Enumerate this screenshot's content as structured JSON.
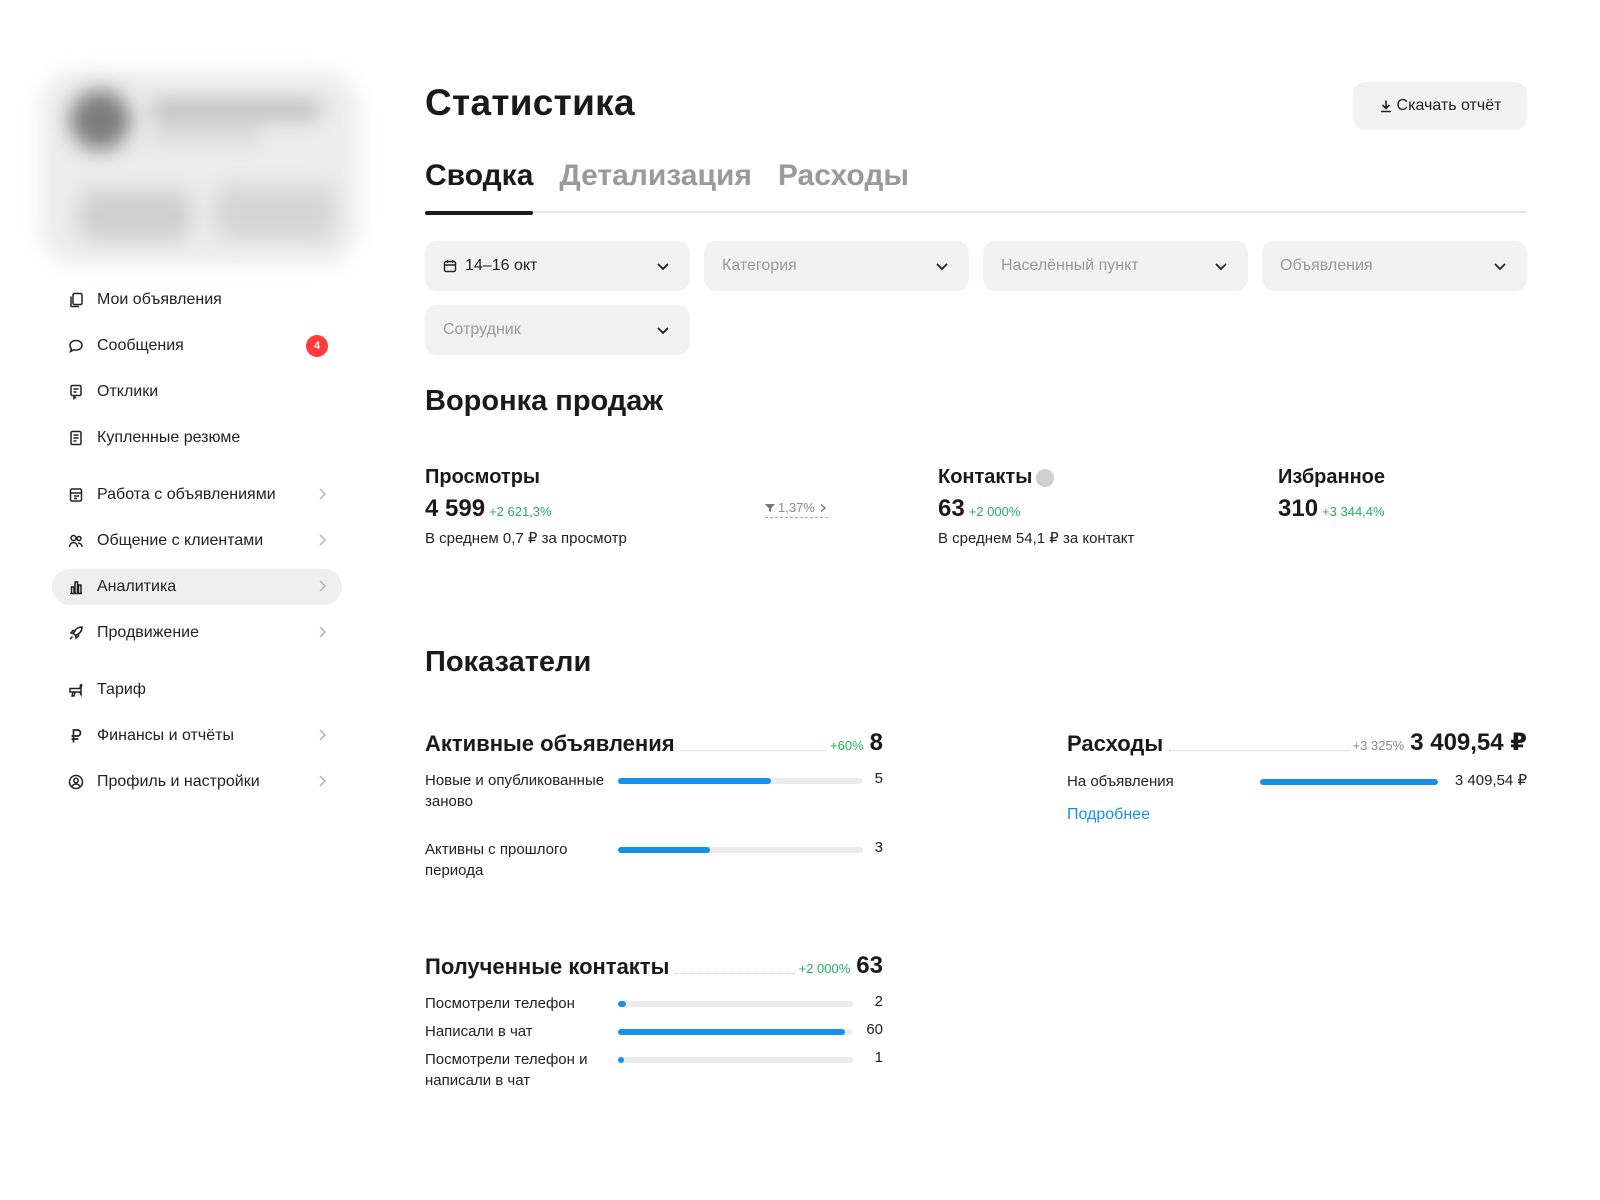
{
  "sidebar": {
    "items": [
      {
        "label": "Мои объявления",
        "icon": "ad-copy-icon",
        "chevron": false
      },
      {
        "label": "Сообщения",
        "icon": "chat-bubble-icon",
        "chevron": false,
        "badge": "4"
      },
      {
        "label": "Отклики",
        "icon": "responses-icon",
        "chevron": false
      },
      {
        "label": "Купленные резюме",
        "icon": "resume-icon",
        "chevron": false
      },
      {
        "label": "Работа с объявлениями",
        "icon": "ads-work-icon",
        "chevron": true
      },
      {
        "label": "Общение с клиентами",
        "icon": "clients-icon",
        "chevron": true
      },
      {
        "label": "Аналитика",
        "icon": "analytics-icon",
        "chevron": true,
        "active": true
      },
      {
        "label": "Продвижение",
        "icon": "rocket-icon",
        "chevron": true
      },
      {
        "label": "Тариф",
        "icon": "tariff-icon",
        "chevron": false
      },
      {
        "label": "Финансы и отчёты",
        "icon": "ruble-icon",
        "chevron": true
      },
      {
        "label": "Профиль и настройки",
        "icon": "profile-icon",
        "chevron": true
      }
    ]
  },
  "header": {
    "title": "Статистика",
    "download_label": "Скачать отчёт"
  },
  "tabs": [
    "Сводка",
    "Детализация",
    "Расходы"
  ],
  "filters": {
    "date": "14–16 окт",
    "category": "Категория",
    "locality": "Населённый пункт",
    "ads": "Объявления",
    "employee": "Сотрудник"
  },
  "funnel": {
    "title": "Воронка продаж",
    "views": {
      "label": "Просмотры",
      "value": "4 599",
      "delta": "+2 621,3%",
      "note": "В среднем 0,7 ₽ за просмотр"
    },
    "conversion": "1,37%",
    "contacts": {
      "label": "Контакты",
      "value": "63",
      "delta": "+2 000%",
      "note": "В среднем 54,1 ₽ за контакт"
    },
    "favorites": {
      "label": "Избранное",
      "value": "310",
      "delta": "+3 344,4%"
    }
  },
  "indicators": {
    "title": "Показатели",
    "active_ads": {
      "title": "Активные объявления",
      "delta": "+60%",
      "value": "8",
      "rows": [
        {
          "label": "Новые и опубликованные заново",
          "value": "5",
          "fraction": 0.625
        },
        {
          "label": "Активны с прошлого периода",
          "value": "3",
          "fraction": 0.375
        }
      ]
    },
    "expenses": {
      "title": "Расходы",
      "delta": "+3 325%",
      "value": "3 409,54 ₽",
      "rows": [
        {
          "label": "На объявления",
          "value": "3 409,54 ₽",
          "fraction": 1.0
        }
      ],
      "more_link": "Подробнее"
    },
    "contacts": {
      "title": "Полученные контакты",
      "delta": "+2 000%",
      "value": "63",
      "rows": [
        {
          "label": "Посмотрели телефон",
          "value": "2",
          "fraction": 0.033
        },
        {
          "label": "Написали в чат",
          "value": "60",
          "fraction": 0.967
        },
        {
          "label": "Посмотрели телефон и написали в чат",
          "value": "1",
          "fraction": 0.017
        }
      ]
    }
  },
  "colors": {
    "accent": "#1790ea",
    "positive": "#21b35a",
    "badge": "#ff3b3b"
  }
}
